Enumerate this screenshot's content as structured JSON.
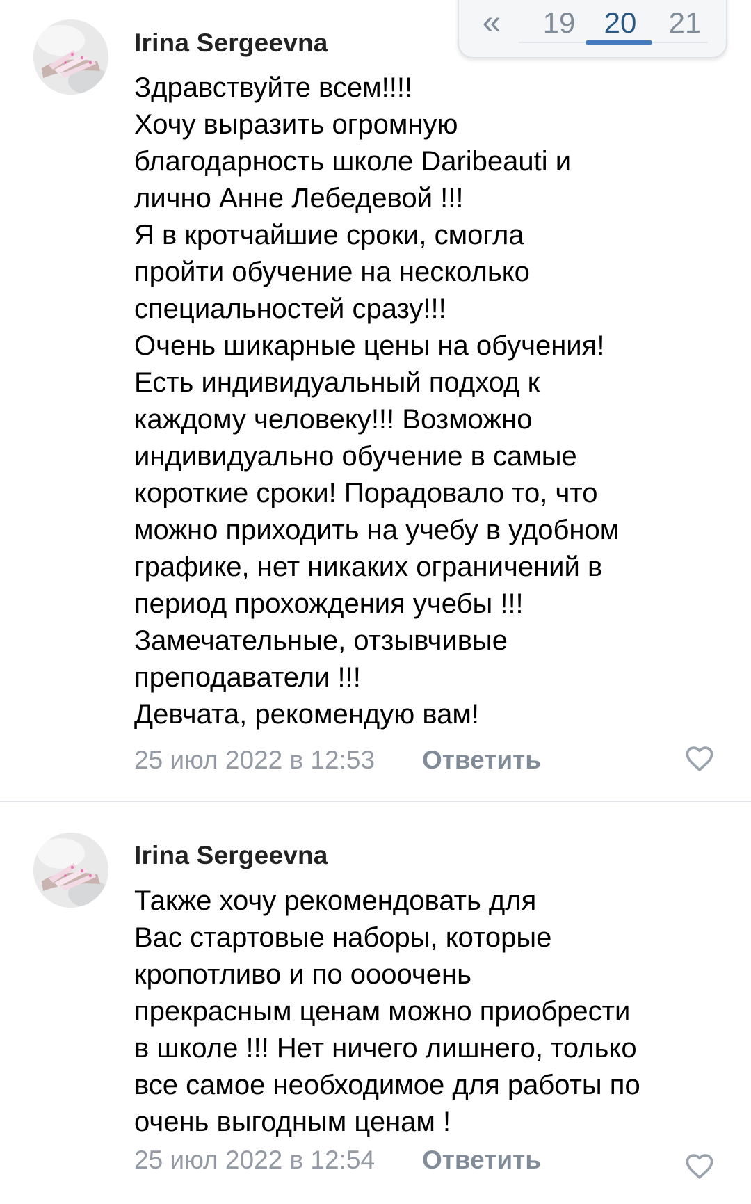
{
  "pagination": {
    "prev_symbol": "«",
    "pages": [
      "19",
      "20",
      "21"
    ],
    "current": "20"
  },
  "comments": [
    {
      "author": "Irina Sergeevna",
      "text": "Здравствуйте всем!!!!\nХочу выразить огромную\nблагодарность школе Daribeauti и\nлично Анне Лебедевой !!!\nЯ в кротчайшие сроки, смогла\nпройти обучение на несколько\nспециальностей сразу!!!\nОчень шикарные цены на обучения!\nЕсть индивидуальный подход к\nкаждому человеку!!! Возможно\nиндивидуально обучение в самые\nкороткие сроки! Порадовало то, что\nможно приходить на учебу в удобном\nграфике, нет никаких ограничений в\nпериод прохождения учебы !!!\nЗамечательные, отзывчивые\nпреподаватели !!!\nДевчата, рекомендую вам!",
      "date": "25 июл 2022 в 12:53",
      "reply_label": "Ответить",
      "avatar_icon": "nails-photo-avatar",
      "like_icon": "heart-outline-icon"
    },
    {
      "author": "Irina Sergeevna",
      "text": "Также хочу рекомендовать для\nВас стартовые наборы, которые\nкропотливо и по оооочень\nпрекрасным ценам можно приобрести\nв школе !!! Нет ничего лишнего, только\nвсе самое необходимое для работы по\nочень выгодным ценам !",
      "date": "25 июл 2022 в 12:54",
      "reply_label": "Ответить",
      "avatar_icon": "nails-photo-avatar",
      "like_icon": "heart-outline-icon"
    }
  ],
  "colors": {
    "text": "#000000",
    "author": "#222222",
    "meta": "#939aa3",
    "active_page": "#2a5885",
    "active_underline": "#447bba",
    "divider": "#e2e5e9"
  }
}
